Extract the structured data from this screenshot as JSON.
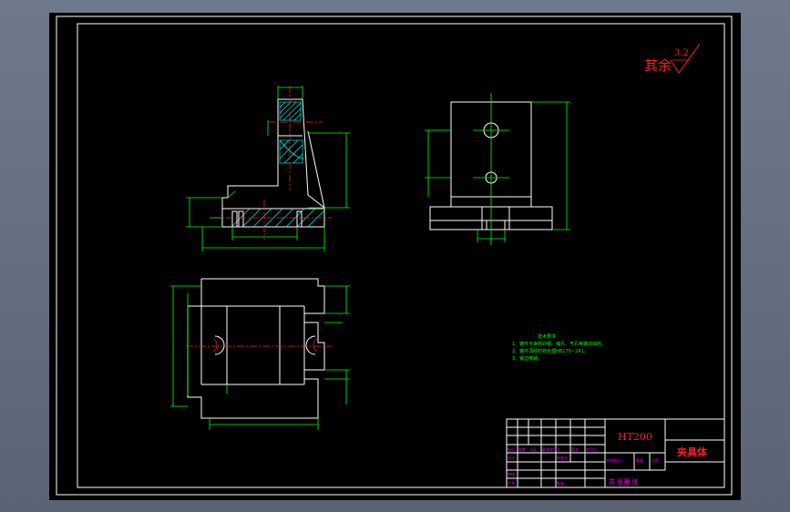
{
  "roughness_note": {
    "prefix": "其余",
    "value": "3.2"
  },
  "tech_notes": {
    "title": "技术要求",
    "items": [
      "1、铸件不得有砂眼、缩孔、气孔等铸造缺陷。",
      "2、铸件须经时效处理HB170~241。",
      "3、锐边倒钝。"
    ]
  },
  "title_block": {
    "material": "HT200",
    "part_name": "夹具体",
    "sheet_info": "共  张第  张",
    "labels": [
      "标记",
      "处数",
      "分区",
      "更改文件号",
      "签名",
      "年月日",
      "设计",
      "标准化",
      "阶段标记",
      "重量",
      "比例",
      "审核",
      "工艺",
      "批准"
    ]
  },
  "colors": {
    "frame": "#ffffff",
    "dimension": "#00ff00",
    "centerline": "#ff2222",
    "hatch": "#00ffff",
    "title_text": "#ff00ff"
  }
}
